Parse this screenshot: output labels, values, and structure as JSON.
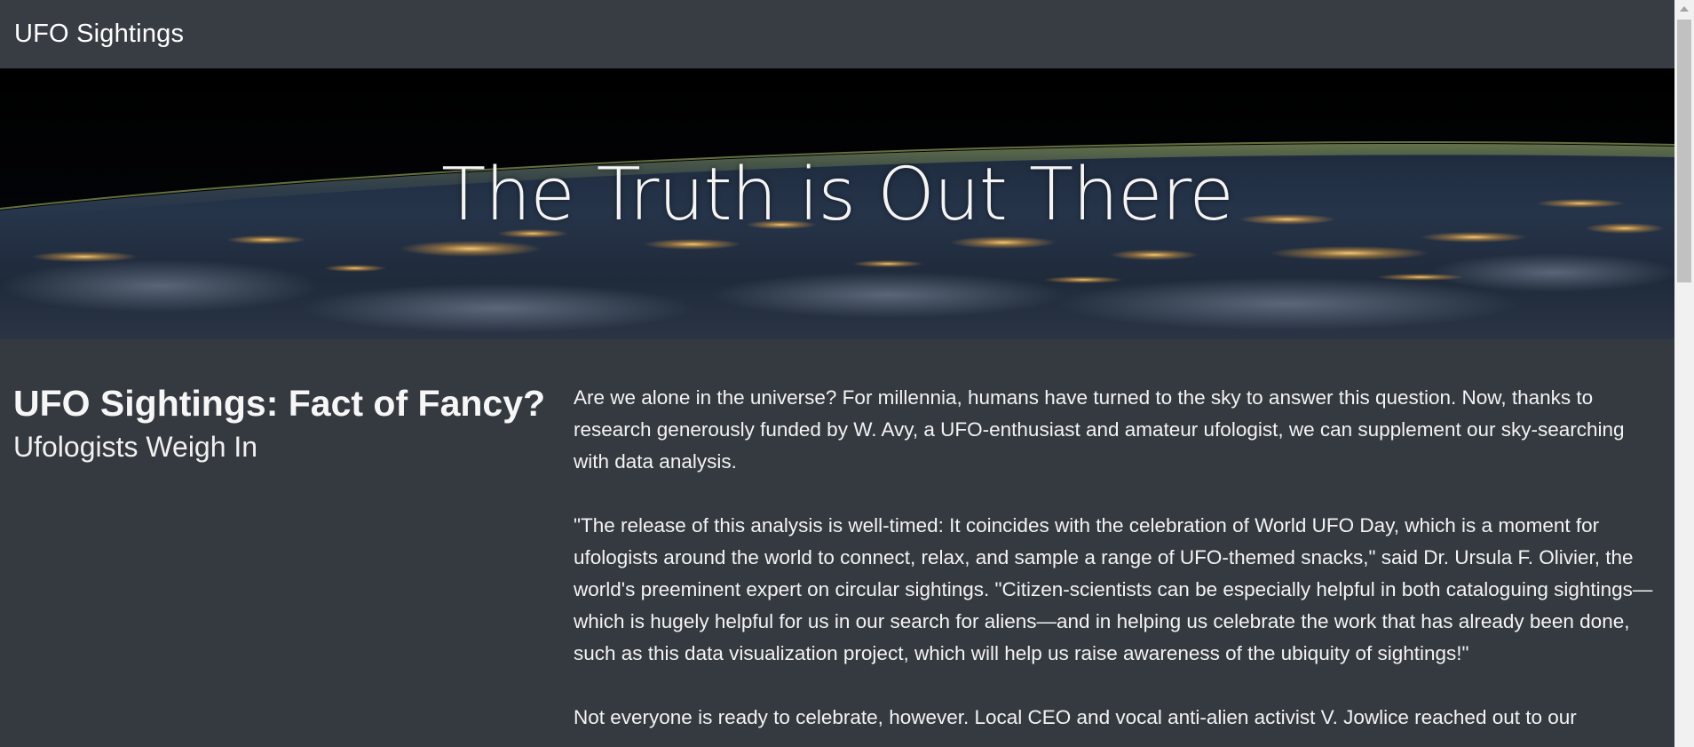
{
  "navbar": {
    "brand": "UFO Sightings"
  },
  "hero": {
    "title": "The Truth is Out There"
  },
  "article": {
    "heading": "UFO Sightings: Fact of Fancy?",
    "subheading": "Ufologists Weigh In",
    "paragraphs": [
      "Are we alone in the universe? For millennia, humans have turned to the sky to answer this question. Now, thanks to research generously funded by W. Avy, a UFO-enthusiast and amateur ufologist, we can supplement our sky-searching with data analysis.",
      "\"The release of this analysis is well-timed: It coincides with the celebration of World UFO Day, which is a moment for ufologists around the world to connect, relax, and sample a range of UFO-themed snacks,\" said Dr. Ursula F. Olivier, the world's preeminent expert on circular sightings. \"Citizen-scientists can be especially helpful in both cataloguing sightings—which is hugely helpful for us in our search for aliens—and in helping us celebrate the work that has already been done, such as this data visualization project, which will help us raise awareness of the ubiquity of sightings!\"",
      "Not everyone is ready to celebrate, however. Local CEO and vocal anti-alien activist V. Jowlice reached out to our"
    ]
  },
  "colors": {
    "background": "#343a40",
    "navbar": "#383d44",
    "text": "#f2f2f2"
  }
}
